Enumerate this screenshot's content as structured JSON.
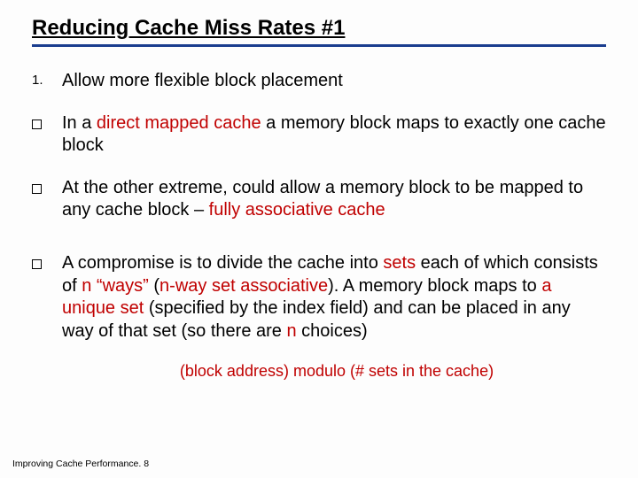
{
  "title": "Reducing Cache Miss Rates #1",
  "items": {
    "num1": {
      "marker": "1.",
      "text": "Allow more flexible block placement"
    },
    "b1": {
      "pre": "In a ",
      "red": "direct mapped cache",
      "post": " a memory block maps to exactly one cache block"
    },
    "b2": {
      "pre": "At the other extreme, could allow a memory block to be mapped to any cache block – ",
      "red": "fully associative cache"
    },
    "b3": {
      "t1": "A compromise is to divide the cache into ",
      "r1": "sets",
      "t2": " each of which consists of ",
      "r2": "n “ways”",
      "t3": " (",
      "r3": "n-way set associative",
      "t4": ").  A memory block maps to ",
      "r4": "a unique set",
      "t5": " (specified by the index field) and can be placed in any way of that set (so there are ",
      "r5": "n",
      "t6": " choices)"
    }
  },
  "formula": "(block address) modulo (# sets in the cache)",
  "footer": "Improving Cache Performance. 8"
}
